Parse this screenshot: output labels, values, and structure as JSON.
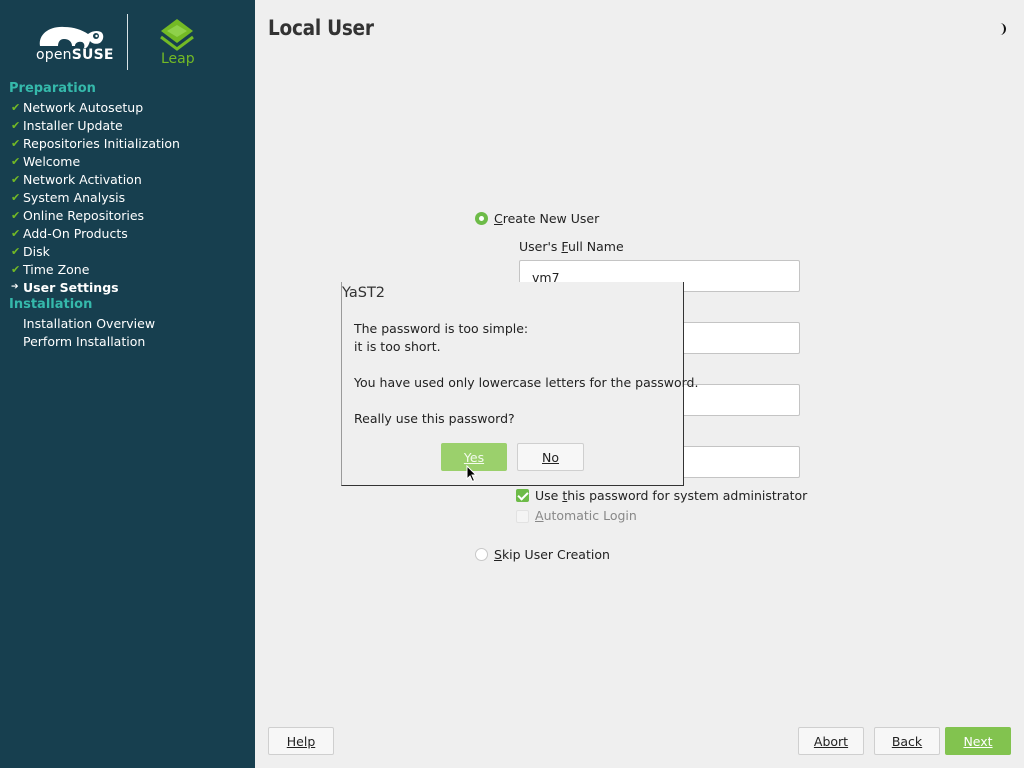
{
  "branding": {
    "opensuse_prefix": "open",
    "opensuse_suffix": "SUSE",
    "leap": "Leap"
  },
  "sidebar": {
    "sections": [
      {
        "title": "Preparation"
      },
      {
        "title": "Installation"
      }
    ],
    "steps": [
      {
        "label": "Network Autosetup",
        "state": "done"
      },
      {
        "label": "Installer Update",
        "state": "done"
      },
      {
        "label": "Repositories Initialization",
        "state": "done"
      },
      {
        "label": "Welcome",
        "state": "done"
      },
      {
        "label": "Network Activation",
        "state": "done"
      },
      {
        "label": "System Analysis",
        "state": "done"
      },
      {
        "label": "Online Repositories",
        "state": "done"
      },
      {
        "label": "Add-On Products",
        "state": "done"
      },
      {
        "label": "Disk",
        "state": "done"
      },
      {
        "label": "Time Zone",
        "state": "done"
      },
      {
        "label": "User Settings",
        "state": "current"
      },
      {
        "label": "Installation Overview",
        "state": "pending"
      },
      {
        "label": "Perform Installation",
        "state": "pending"
      }
    ],
    "done_mark": "✔",
    "current_mark": "➔"
  },
  "main": {
    "title": "Local User",
    "create_user": {
      "label_underlined": "C",
      "label_rest": "reate New User",
      "selected": true
    },
    "full_name": {
      "label_pre": "User's ",
      "label_underlined": "F",
      "label_post": "ull Name",
      "value": "vm7"
    },
    "use_password_admin": {
      "label_pre": "Use ",
      "label_underlined": "t",
      "label_post": "his password for system administrator",
      "checked": true
    },
    "auto_login": {
      "label_underlined": "A",
      "label_rest": "utomatic Login",
      "checked": false
    },
    "skip_user": {
      "label_underlined": "S",
      "label_rest": "kip User Creation",
      "selected": false
    }
  },
  "dialog": {
    "title": "YaST2",
    "line1": "The password is too simple:",
    "line2": "it is too short.",
    "line3": "You have used only lowercase letters for the password.",
    "line4": "Really use this password?",
    "yes_label": "Yes",
    "no_label": "No"
  },
  "footer": {
    "help_label": "Help",
    "abort_label": "Abort",
    "back_label": "Back",
    "next_label": "Next"
  },
  "colors": {
    "sidebar_bg": "#173f4f",
    "accent_green": "#73ba25",
    "section_teal": "#35b9ab",
    "button_green": "#82c34f"
  }
}
